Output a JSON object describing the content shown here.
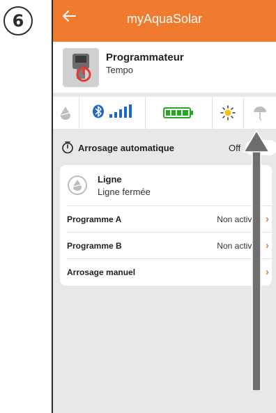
{
  "step_number": "6",
  "app": {
    "title": "myAquaSolar"
  },
  "device": {
    "name": "Programmateur",
    "model": "Tempo"
  },
  "status_bar": {
    "icons": [
      "water-drop-icon",
      "bluetooth-icon",
      "signal-bars-icon",
      "battery-icon",
      "sun-icon",
      "umbrella-icon"
    ]
  },
  "auto_watering": {
    "label": "Arrosage automatique",
    "value": "Off"
  },
  "line": {
    "title": "Ligne",
    "status": "Ligne fermée"
  },
  "programs": [
    {
      "label": "Programme A",
      "value": "Non activé"
    },
    {
      "label": "Programme B",
      "value": "Non activé"
    },
    {
      "label": "Arrosage manuel",
      "value": ""
    }
  ],
  "colors": {
    "accent": "#f07a2e",
    "bluetooth": "#1f66c9",
    "battery": "#2aa52a",
    "sun": "#f4c20d",
    "background": "#e8e8e8",
    "annotation_arrow": "#6e6e6e"
  }
}
